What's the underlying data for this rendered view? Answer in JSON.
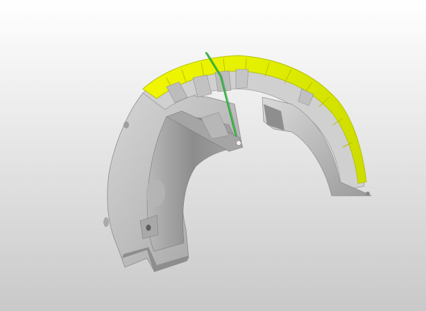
{
  "viewport": {
    "background_top": "#ffffff",
    "background_bottom": "#c9c9c9"
  },
  "model": {
    "part": "wheel-arch-liner",
    "body_color": "#c4c4c4",
    "highlight_color": "#e4f000",
    "highlight_edge_color": "#b5c200",
    "section_line_color": "#35b040"
  }
}
